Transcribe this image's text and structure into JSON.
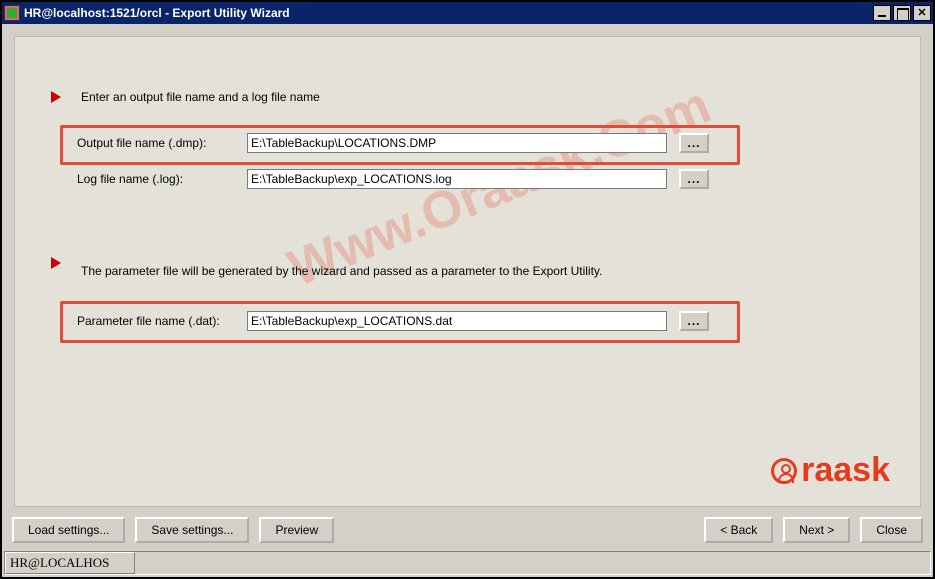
{
  "window": {
    "title": "HR@localhost:1521/orcl - Export Utility Wizard"
  },
  "section1": {
    "instruction": "Enter an output file name and a log file name",
    "output_label": "Output file name (.dmp):",
    "output_value": "E:\\TableBackup\\LOCATIONS.DMP",
    "log_label": "Log file name (.log):",
    "log_value": "E:\\TableBackup\\exp_LOCATIONS.log",
    "browse_label": "..."
  },
  "section2": {
    "instruction": "The parameter file will be generated by the wizard and passed as a parameter to the Export Utility.",
    "param_label": "Parameter file name (.dat):",
    "param_value": "E:\\TableBackup\\exp_LOCATIONS.dat",
    "browse_label": "..."
  },
  "buttons": {
    "load": "Load settings...",
    "save": "Save settings...",
    "preview": "Preview",
    "back": "< Back",
    "next": "Next >",
    "close": "Close"
  },
  "status": {
    "connection": "HR@LOCALHOS"
  },
  "watermark": "Www.Oraask.Com",
  "brand": "raask"
}
